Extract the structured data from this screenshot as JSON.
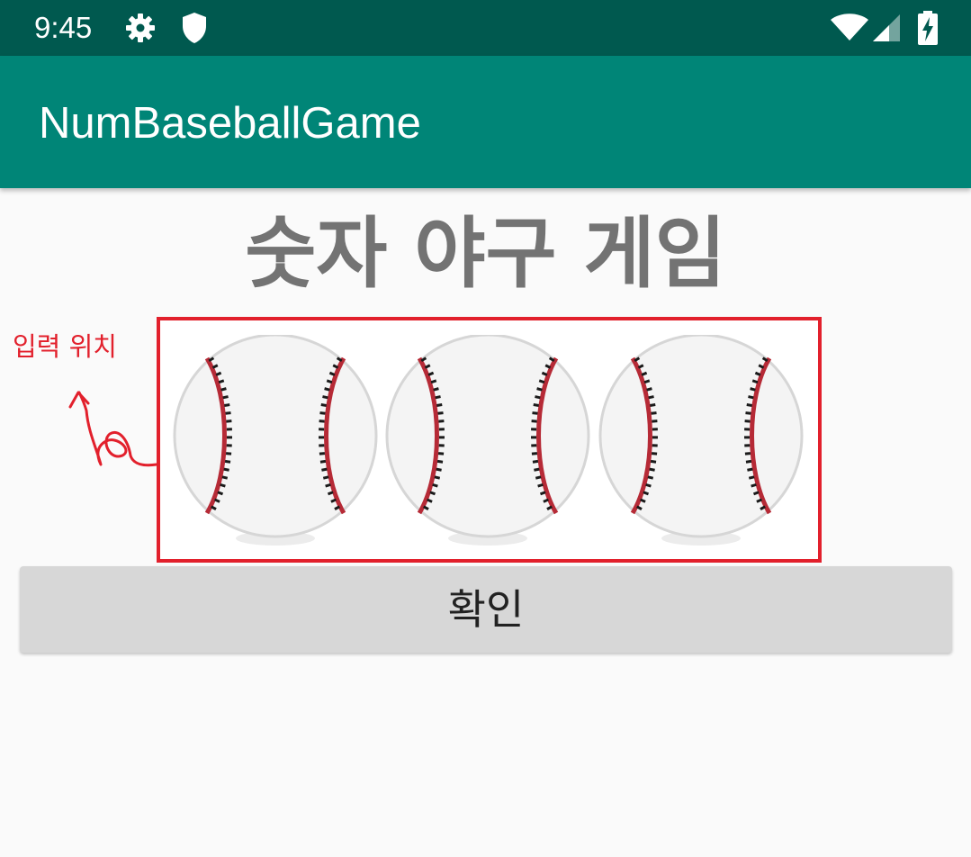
{
  "status_bar": {
    "time": "9:45",
    "icons": [
      "gear-icon",
      "shield-icon",
      "wifi-icon",
      "signal-icon",
      "battery-charging-icon"
    ]
  },
  "app_bar": {
    "title": "NumBaseballGame"
  },
  "main": {
    "title": "숫자 야구 게임",
    "input_slots": [
      {
        "icon": "baseball-icon"
      },
      {
        "icon": "baseball-icon"
      },
      {
        "icon": "baseball-icon"
      }
    ],
    "annotation": {
      "label": "입력 위치"
    },
    "confirm_label": "확인"
  },
  "colors": {
    "status_bar": "#00594f",
    "app_bar": "#008577",
    "title_text": "#737373",
    "annotation": "#e2202c",
    "button": "#d7d7d7"
  }
}
